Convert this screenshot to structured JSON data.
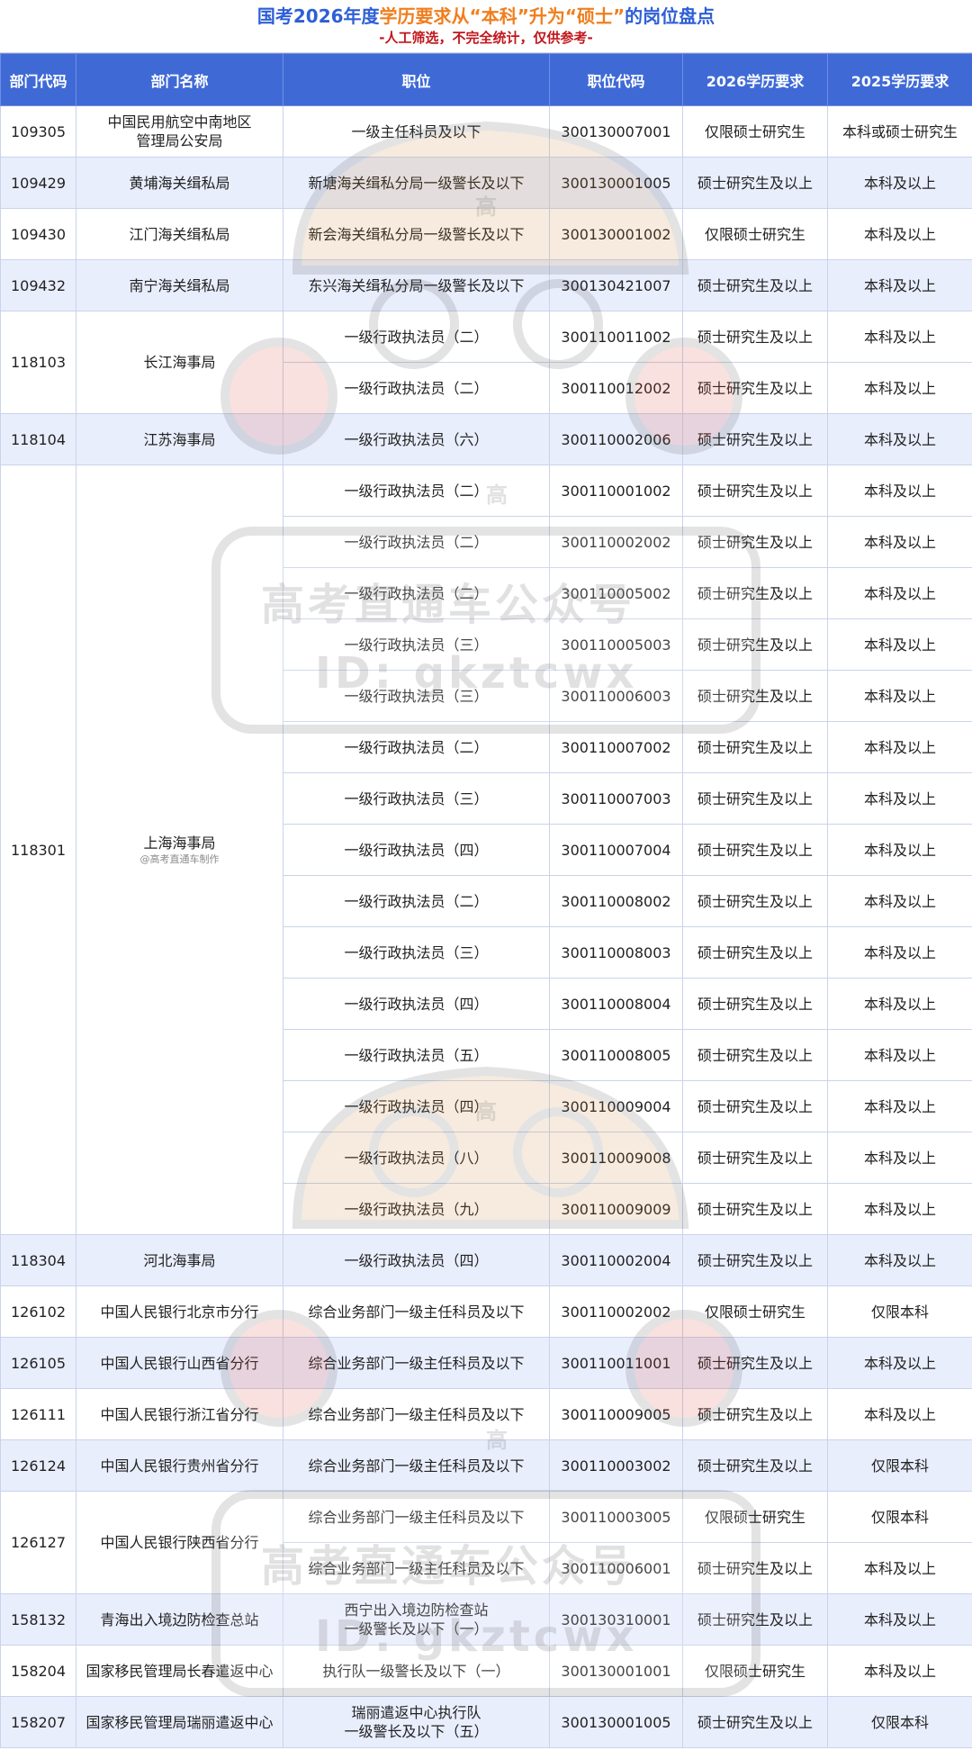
{
  "header": {
    "title_part1": "国考2026年度",
    "title_part2": "学历要求从“本科”升为“硕士”",
    "title_part3": "的岗位盘点",
    "subtitle": "-人工筛选，不完全统计，仅供参考-"
  },
  "table": {
    "columns": [
      "部门代码",
      "部门名称",
      "职位",
      "职位代码",
      "2026学历要求",
      "2025学历要求"
    ],
    "groups": [
      {
        "code": "109305",
        "name": "中国民用航空中南地区\n管理局公安局",
        "rows": [
          {
            "position": "一级主任科员及以下",
            "pcode": "300130007001",
            "req2026": "仅限硕士研究生",
            "req2025": "本科或硕士研究生"
          }
        ]
      },
      {
        "code": "109429",
        "name": "黄埔海关缉私局",
        "rows": [
          {
            "position": "新塘海关缉私分局一级警长及以下",
            "pcode": "300130001005",
            "req2026": "硕士研究生及以上",
            "req2025": "本科及以上"
          }
        ]
      },
      {
        "code": "109430",
        "name": "江门海关缉私局",
        "rows": [
          {
            "position": "新会海关缉私分局一级警长及以下",
            "pcode": "300130001002",
            "req2026": "仅限硕士研究生",
            "req2025": "本科及以上"
          }
        ]
      },
      {
        "code": "109432",
        "name": "南宁海关缉私局",
        "rows": [
          {
            "position": "东兴海关缉私分局一级警长及以下",
            "pcode": "300130421007",
            "req2026": "硕士研究生及以上",
            "req2025": "本科及以上"
          }
        ]
      },
      {
        "code": "118103",
        "name": "长江海事局",
        "rows": [
          {
            "position": "一级行政执法员（二）",
            "pcode": "300110011002",
            "req2026": "硕士研究生及以上",
            "req2025": "本科及以上"
          },
          {
            "position": "一级行政执法员（二）",
            "pcode": "300110012002",
            "req2026": "硕士研究生及以上",
            "req2025": "本科及以上"
          }
        ]
      },
      {
        "code": "118104",
        "name": "江苏海事局",
        "rows": [
          {
            "position": "一级行政执法员（六）",
            "pcode": "300110002006",
            "req2026": "硕士研究生及以上",
            "req2025": "本科及以上"
          }
        ]
      },
      {
        "code": "118301",
        "name": "上海海事局",
        "credit": "@高考直通车制作",
        "rows": [
          {
            "position": "一级行政执法员（二）",
            "pcode": "300110001002",
            "req2026": "硕士研究生及以上",
            "req2025": "本科及以上"
          },
          {
            "position": "一级行政执法员（二）",
            "pcode": "300110002002",
            "req2026": "硕士研究生及以上",
            "req2025": "本科及以上"
          },
          {
            "position": "一级行政执法员（二）",
            "pcode": "300110005002",
            "req2026": "硕士研究生及以上",
            "req2025": "本科及以上"
          },
          {
            "position": "一级行政执法员（三）",
            "pcode": "300110005003",
            "req2026": "硕士研究生及以上",
            "req2025": "本科及以上"
          },
          {
            "position": "一级行政执法员（三）",
            "pcode": "300110006003",
            "req2026": "硕士研究生及以上",
            "req2025": "本科及以上"
          },
          {
            "position": "一级行政执法员（二）",
            "pcode": "300110007002",
            "req2026": "硕士研究生及以上",
            "req2025": "本科及以上"
          },
          {
            "position": "一级行政执法员（三）",
            "pcode": "300110007003",
            "req2026": "硕士研究生及以上",
            "req2025": "本科及以上"
          },
          {
            "position": "一级行政执法员（四）",
            "pcode": "300110007004",
            "req2026": "硕士研究生及以上",
            "req2025": "本科及以上"
          },
          {
            "position": "一级行政执法员（二）",
            "pcode": "300110008002",
            "req2026": "硕士研究生及以上",
            "req2025": "本科及以上"
          },
          {
            "position": "一级行政执法员（三）",
            "pcode": "300110008003",
            "req2026": "硕士研究生及以上",
            "req2025": "本科及以上"
          },
          {
            "position": "一级行政执法员（四）",
            "pcode": "300110008004",
            "req2026": "硕士研究生及以上",
            "req2025": "本科及以上"
          },
          {
            "position": "一级行政执法员（五）",
            "pcode": "300110008005",
            "req2026": "硕士研究生及以上",
            "req2025": "本科及以上"
          },
          {
            "position": "一级行政执法员（四）",
            "pcode": "300110009004",
            "req2026": "硕士研究生及以上",
            "req2025": "本科及以上"
          },
          {
            "position": "一级行政执法员（八）",
            "pcode": "300110009008",
            "req2026": "硕士研究生及以上",
            "req2025": "本科及以上"
          },
          {
            "position": "一级行政执法员（九）",
            "pcode": "300110009009",
            "req2026": "硕士研究生及以上",
            "req2025": "本科及以上"
          }
        ]
      },
      {
        "code": "118304",
        "name": "河北海事局",
        "rows": [
          {
            "position": "一级行政执法员（四）",
            "pcode": "300110002004",
            "req2026": "硕士研究生及以上",
            "req2025": "本科及以上"
          }
        ]
      },
      {
        "code": "126102",
        "name": "中国人民银行北京市分行",
        "rows": [
          {
            "position": "综合业务部门一级主任科员及以下",
            "pcode": "300110002002",
            "req2026": "仅限硕士研究生",
            "req2025": "仅限本科"
          }
        ]
      },
      {
        "code": "126105",
        "name": "中国人民银行山西省分行",
        "rows": [
          {
            "position": "综合业务部门一级主任科员及以下",
            "pcode": "300110011001",
            "req2026": "硕士研究生及以上",
            "req2025": "本科及以上"
          }
        ]
      },
      {
        "code": "126111",
        "name": "中国人民银行浙江省分行",
        "rows": [
          {
            "position": "综合业务部门一级主任科员及以下",
            "pcode": "300110009005",
            "req2026": "硕士研究生及以上",
            "req2025": "本科及以上"
          }
        ]
      },
      {
        "code": "126124",
        "name": "中国人民银行贵州省分行",
        "rows": [
          {
            "position": "综合业务部门一级主任科员及以下",
            "pcode": "300110003002",
            "req2026": "硕士研究生及以上",
            "req2025": "仅限本科"
          }
        ]
      },
      {
        "code": "126127",
        "name": "中国人民银行陕西省分行",
        "rows": [
          {
            "position": "综合业务部门一级主任科员及以下",
            "pcode": "300110003005",
            "req2026": "仅限硕士研究生",
            "req2025": "仅限本科"
          },
          {
            "position": "综合业务部门一级主任科员及以下",
            "pcode": "300110006001",
            "req2026": "硕士研究生及以上",
            "req2025": "本科及以上"
          }
        ]
      },
      {
        "code": "158132",
        "name": "青海出入境边防检查总站",
        "rows": [
          {
            "position": "西宁出入境边防检查站\n一级警长及以下（一）",
            "pcode": "300130310001",
            "req2026": "硕士研究生及以上",
            "req2025": "本科及以上"
          }
        ]
      },
      {
        "code": "158204",
        "name": "国家移民管理局长春遣返中心",
        "rows": [
          {
            "position": "执行队一级警长及以下（一）",
            "pcode": "300130001001",
            "req2026": "仅限硕士研究生",
            "req2025": "本科及以上"
          }
        ]
      },
      {
        "code": "158207",
        "name": "国家移民管理局瑞丽遣返中心",
        "rows": [
          {
            "position": "瑞丽遣返中心执行队\n一级警长及以下（五）",
            "pcode": "300130001005",
            "req2026": "硕士研究生及以上",
            "req2025": "仅限本科"
          }
        ]
      }
    ]
  },
  "watermark": {
    "line1": "高考直通车公众号",
    "line2": "ID: gkztcwx",
    "badge": "高"
  }
}
